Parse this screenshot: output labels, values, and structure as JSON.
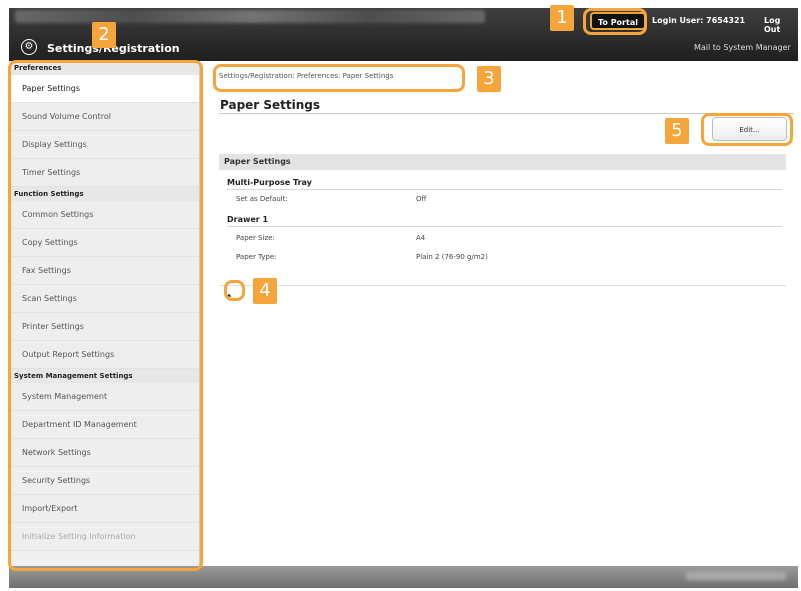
{
  "header": {
    "to_portal": "To Portal",
    "login_user": "Login User: 7654321",
    "log_out": "Log Out",
    "mail_link": "Mail to System Manager",
    "title": "Settings/Registration"
  },
  "sidebar": {
    "groups": [
      {
        "heading": "Preferences",
        "items": [
          "Paper Settings",
          "Sound Volume Control",
          "Display Settings",
          "Timer Settings"
        ]
      },
      {
        "heading": "Function Settings",
        "items": [
          "Common Settings",
          "Copy Settings",
          "Fax Settings",
          "Scan Settings",
          "Printer Settings",
          "Output Report Settings"
        ]
      },
      {
        "heading": "System Management Settings",
        "items": [
          "System Management",
          "Department ID Management",
          "Network Settings",
          "Security Settings",
          "Import/Export",
          "Initialize Setting Information"
        ]
      }
    ]
  },
  "main": {
    "breadcrumb": "Settings/Registration: Preferences: Paper Settings",
    "page_title": "Paper Settings",
    "edit_label": "Edit...",
    "section_title": "Paper Settings",
    "multi_purpose": {
      "heading": "Multi-Purpose Tray",
      "rows": [
        {
          "label": "Set as Default:",
          "value": "Off"
        }
      ]
    },
    "drawer": {
      "heading": "Drawer 1",
      "rows": [
        {
          "label": "Paper Size:",
          "value": "A4"
        },
        {
          "label": "Paper Type:",
          "value": "Plain 2 (76-90 g/m2)"
        }
      ]
    }
  },
  "callouts": [
    "1",
    "2",
    "3",
    "4",
    "5"
  ],
  "colors": {
    "accent": "#f5a53a",
    "topbar": "#2b2b2b"
  }
}
